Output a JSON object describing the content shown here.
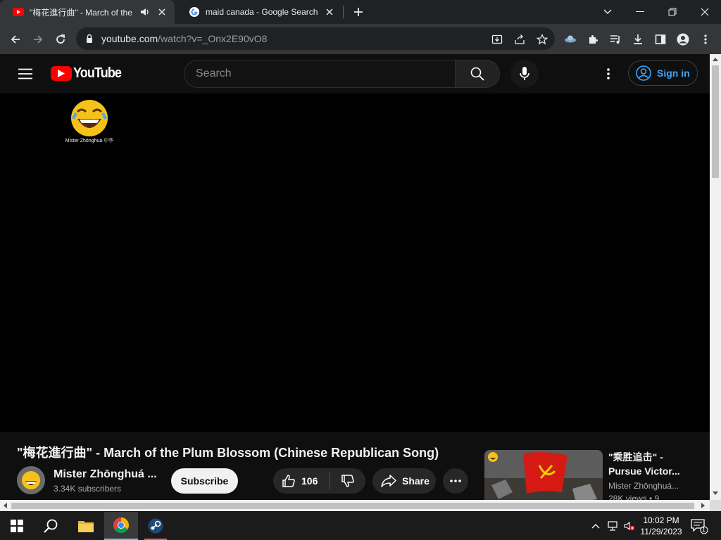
{
  "browser": {
    "tabs": [
      {
        "title": "\"梅花進行曲\" - March of the",
        "active": true
      },
      {
        "title": "maid canada - Google Search",
        "active": false
      }
    ],
    "url_domain": "youtube.com",
    "url_rest": "/watch?v=_Onx2E90vO8"
  },
  "youtube": {
    "logo_text": "YouTube",
    "search_placeholder": "Search",
    "signin_label": "Sign in",
    "watermark_text": "Mister Zhōnghuá 中华",
    "video": {
      "title_cn": "\"梅花進行曲\"",
      "title_rest": " - March of the Plum Blossom (Chinese Republican Song)",
      "channel": "Mister Zhōnghuá ...",
      "subscribers": "3.34K subscribers",
      "subscribe_label": "Subscribe",
      "likes": "106",
      "share_label": "Share"
    },
    "recommendation": {
      "title_line1": "\"乘胜追击\" -",
      "title_line2": "Pursue Victor...",
      "channel": "Mister Zhōnghuá...",
      "views": "28K views • 9"
    }
  },
  "taskbar": {
    "time": "10:02 PM",
    "date": "11/29/2023",
    "notification_count": "1"
  },
  "colors": {
    "youtube_red": "#ff0000",
    "link_blue": "#3ea6ff",
    "page_bg": "#0f0f0f"
  }
}
